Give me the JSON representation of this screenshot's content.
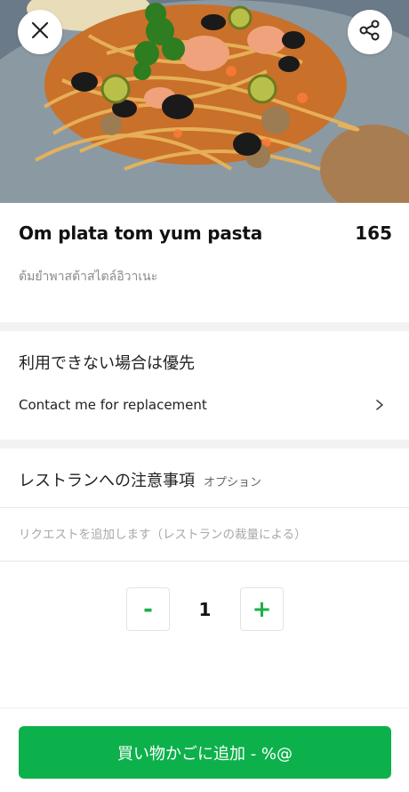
{
  "item": {
    "name": "Om plata tom yum pasta",
    "price": "165",
    "description": "ต้มยำพาสต้าสไตล์อิวาเนะ"
  },
  "unavailable": {
    "title": "利用できない場合は優先",
    "option_label": "Contact me for replacement"
  },
  "notes": {
    "title": "レストランへの注意事項",
    "optional_tag": "オプション",
    "placeholder": "リクエストを追加します（レストランの裁量による）"
  },
  "quantity": {
    "minus_label": "-",
    "value": "1",
    "plus_label": "+"
  },
  "cart": {
    "add_label": "買い物かごに追加 - %@"
  },
  "colors": {
    "accent_green": "#0db14b",
    "qty_green": "#1db049"
  },
  "icons": {
    "close": "close-icon",
    "share": "share-icon",
    "chevron": "chevron-right-icon"
  }
}
